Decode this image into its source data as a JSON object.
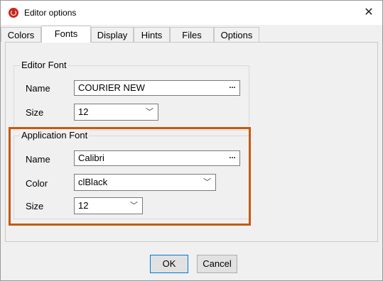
{
  "window": {
    "title": "Editor options",
    "close_glyph": "✕",
    "icon": "app-logo-icon"
  },
  "tabs": [
    {
      "label": "Colors",
      "active": false
    },
    {
      "label": "Fonts",
      "active": true
    },
    {
      "label": "Display",
      "active": false
    },
    {
      "label": "Hints",
      "active": false
    },
    {
      "label": "Files",
      "active": false
    },
    {
      "label": "Options",
      "active": false
    }
  ],
  "editor_font": {
    "title": "Editor Font",
    "name_label": "Name",
    "name_value": "COURIER NEW",
    "size_label": "Size",
    "size_value": "12",
    "browse_glyph": "..."
  },
  "application_font": {
    "title": "Application Font",
    "name_label": "Name",
    "name_value": "Calibri",
    "color_label": "Color",
    "color_value": "clBlack",
    "size_label": "Size",
    "size_value": "12",
    "browse_glyph": "..."
  },
  "buttons": {
    "ok": "OK",
    "cancel": "Cancel"
  },
  "colors": {
    "highlight": "#c55a11",
    "app_icon": "#c8281e"
  }
}
